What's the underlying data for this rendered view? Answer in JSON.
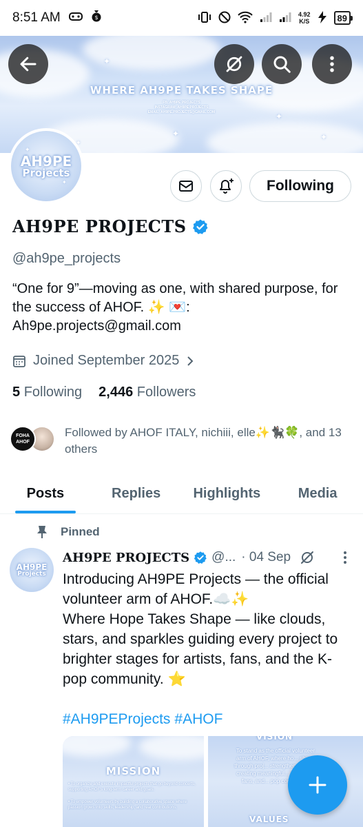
{
  "status_bar": {
    "time": "8:51 AM",
    "speed_value": "4.92",
    "speed_unit": "K/S",
    "battery": "89"
  },
  "banner": {
    "title": "WHERE AH9PE TAKES SHAPE",
    "sub_lines": [
      "FB: AH9PE PROJECTS",
      "INSTAGRAM: AH9PE PROJECTS",
      "EMAIL: AH9PE.PROJECTS@GMAIL.COM"
    ]
  },
  "avatar": {
    "line1": "AH9PE",
    "line2": "Projects"
  },
  "profile": {
    "follow_button": "Following",
    "name": "AH9PE PROJECTS",
    "handle": "@ah9pe_projects",
    "bio": "“One for 9”—moving as one, with shared purpose, for the success of AHOF. ✨ 💌: Ah9pe.projects@gmail.com",
    "joined": "Joined September 2025",
    "following_count": "5",
    "following_label": "Following",
    "followers_count": "2,446",
    "followers_label": "Followers",
    "mini_avatar_text": "FOHA AHOF",
    "followed_by": "Followed by AHOF ITALY, nichiii, elle✨🐈‍⬛🍀, and 13 others"
  },
  "tabs": [
    "Posts",
    "Replies",
    "Highlights",
    "Media"
  ],
  "post": {
    "pinned_label": "Pinned",
    "author": "AH9PE PROJECTS",
    "handle": "@...",
    "date": "· 04 Sep",
    "body_lines": [
      "Introducing AH9PE Projects — the official volunteer arm of AHOF.☁️✨",
      "Where Hope Takes Shape — like clouds, stars, and sparkles guiding every project to brighter stages for artists, fans, and the K-pop community. ⭐"
    ],
    "hashtags": [
      "#AH9PEProjects",
      "#AHOF"
    ],
    "media_left": {
      "title": "MISSION",
      "bullets": [
        "• To organize and execute impactful projects that go beyond concerts, supporting AHOF's long-term career and goals.",
        "• To empower volunteers by building a collaborative space where passion grows into skills, leadership, and real contributions."
      ]
    },
    "media_right": {
      "title_top": "VISION",
      "text": "To stand as the official volunteer arm of AHOF, where ho... shape through proj... strengthen AHOF... creating meaningful... for artists, fans, and... pop commUni...",
      "title_bottom": "VALUES"
    }
  },
  "colors": {
    "accent": "#1d9bf0",
    "text_secondary": "#536471",
    "border": "#cfd9de"
  }
}
